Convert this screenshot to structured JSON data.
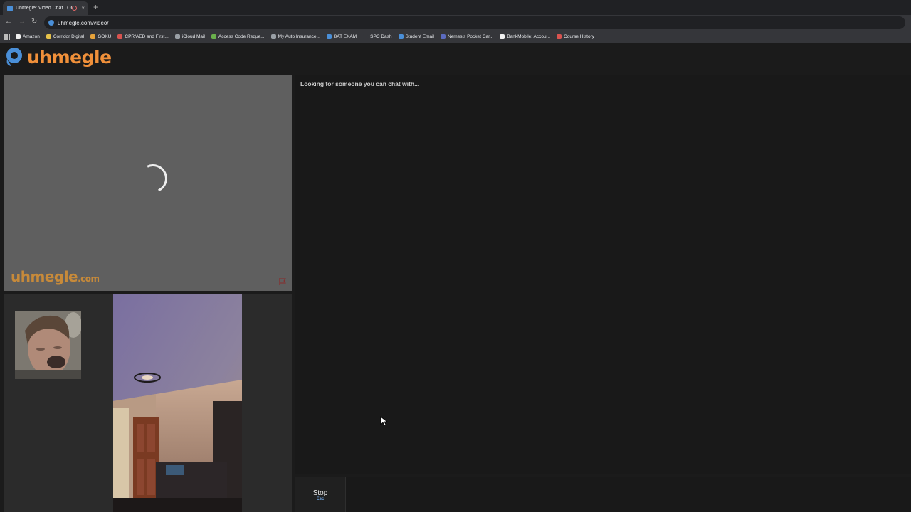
{
  "browser": {
    "tab_title": "Uhmegle: Video Chat | Om...",
    "tab_close": "×",
    "new_tab": "+",
    "url": "uhmegle.com/video/",
    "bookmarks": [
      {
        "label": "Amazon",
        "color": "#f0f0f0"
      },
      {
        "label": "Corridor Digital",
        "color": "#e6c24a"
      },
      {
        "label": "GOKU",
        "color": "#e6a23a"
      },
      {
        "label": "CPR/AED and First...",
        "color": "#d9534f"
      },
      {
        "label": "iCloud Mail",
        "color": "#9aa0a6"
      },
      {
        "label": "Access Code Reque...",
        "color": "#6ab04c"
      },
      {
        "label": "My Auto Insurance...",
        "color": "#9aa0a6"
      },
      {
        "label": "BAT EXAM",
        "color": "#4a8fd8"
      },
      {
        "label": "SPC Dash",
        "color": "#35363a"
      },
      {
        "label": "Student Email",
        "color": "#4a8fd8"
      },
      {
        "label": "Nemesis Pocket Car...",
        "color": "#5b6bc0"
      },
      {
        "label": "BankMobile: Accou...",
        "color": "#f0f0f0"
      },
      {
        "label": "Course History",
        "color": "#d9534f"
      }
    ]
  },
  "site": {
    "logo_text": "uhmegle",
    "watermark_main": "uhmegle",
    "watermark_suffix": ".com",
    "brand_color": "#f0903a",
    "accent_color": "#4a8fd8"
  },
  "chat": {
    "status": "Looking for someone you can chat with..."
  },
  "controls": {
    "stop_label": "Stop",
    "stop_key": "Esc"
  }
}
